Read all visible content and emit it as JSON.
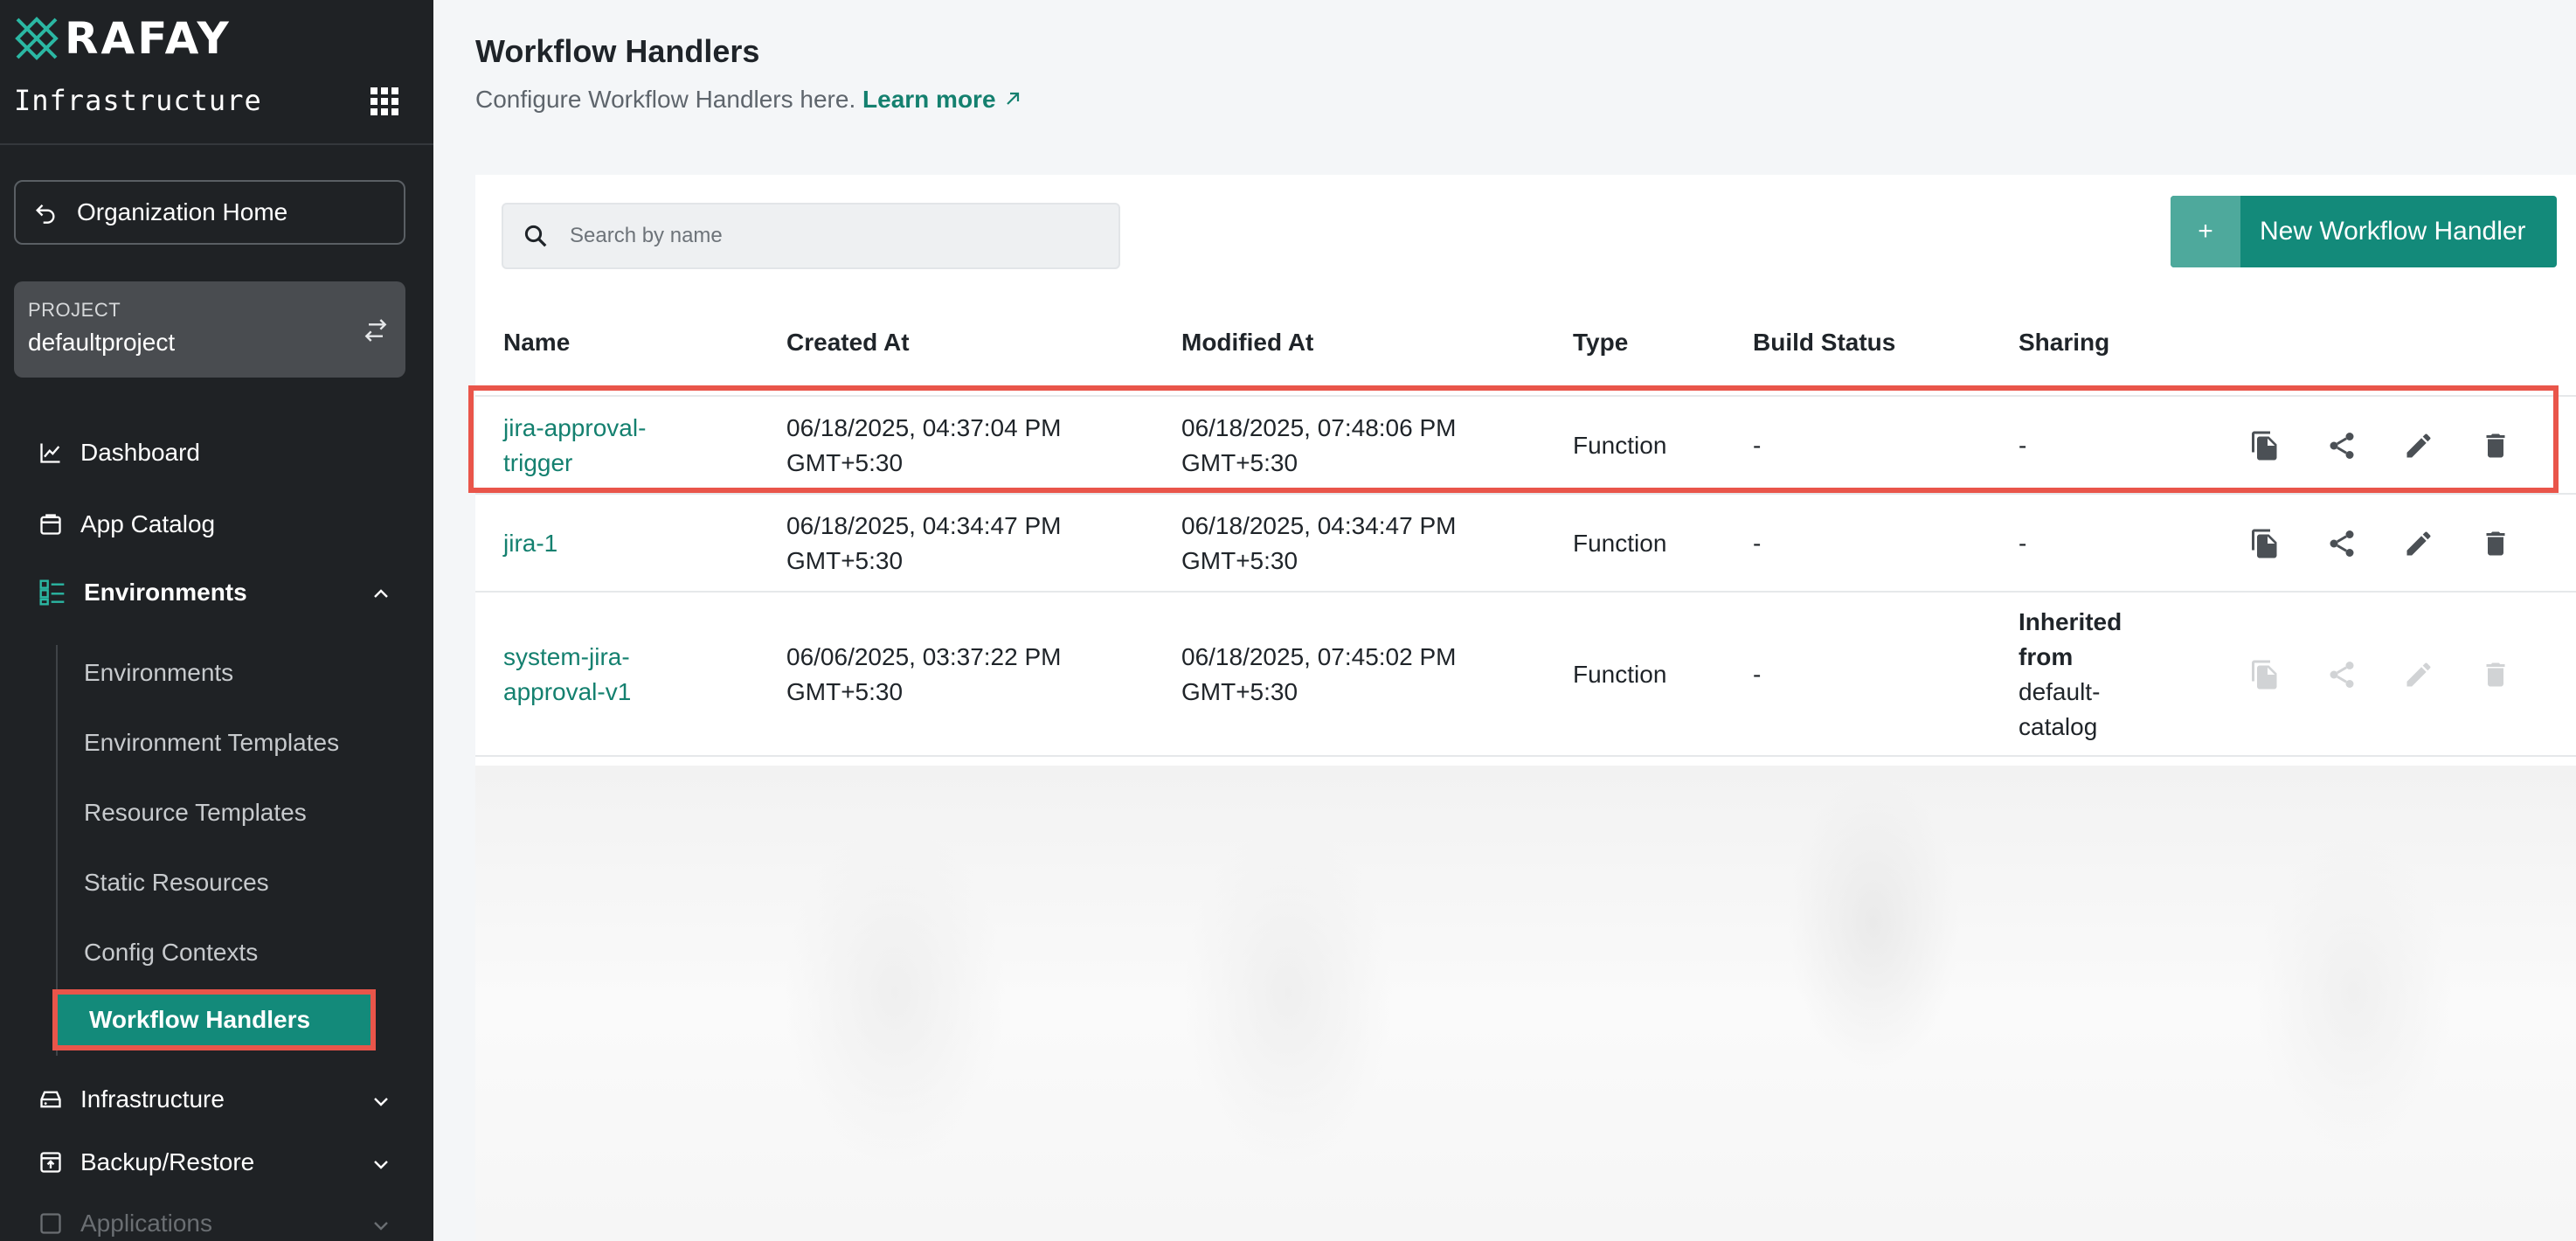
{
  "sidebar": {
    "logo_text": "RAFAY",
    "section_title": "Infrastructure",
    "org_home_label": "Organization Home",
    "project_caption": "PROJECT",
    "project_name": "defaultproject",
    "nav": {
      "dashboard": "Dashboard",
      "app_catalog": "App Catalog",
      "environments": "Environments",
      "infrastructure": "Infrastructure",
      "backup_restore": "Backup/Restore",
      "applications": "Applications"
    },
    "sub_items": {
      "environments": "Environments",
      "environment_templates": "Environment Templates",
      "resource_templates": "Resource Templates",
      "static_resources": "Static Resources",
      "config_contexts": "Config Contexts",
      "workflow_handlers": "Workflow Handlers"
    }
  },
  "header": {
    "title": "Workflow Handlers",
    "subtitle": "Configure Workflow Handlers here.",
    "learn_more": "Learn more"
  },
  "toolbar": {
    "search_placeholder": "Search by name",
    "new_button_plus": "+",
    "new_button_label": "New Workflow Handler"
  },
  "table": {
    "headers": {
      "name": "Name",
      "created": "Created At",
      "modified": "Modified At",
      "type": "Type",
      "build": "Build Status",
      "sharing": "Sharing"
    },
    "rows": [
      {
        "name_l1": "jira-approval-",
        "name_l2": "trigger",
        "created_l1": "06/18/2025, 04:37:04 PM",
        "created_l2": "GMT+5:30",
        "modified_l1": "06/18/2025, 07:48:06 PM",
        "modified_l2": "GMT+5:30",
        "type": "Function",
        "build": "-",
        "sharing": "-"
      },
      {
        "name_l1": "jira-1",
        "created_l1": "06/18/2025, 04:34:47 PM",
        "created_l2": "GMT+5:30",
        "modified_l1": "06/18/2025, 04:34:47 PM",
        "modified_l2": "GMT+5:30",
        "type": "Function",
        "build": "-",
        "sharing": "-"
      },
      {
        "name_l1": "system-jira-",
        "name_l2": "approval-v1",
        "created_l1": "06/06/2025, 03:37:22 PM",
        "created_l2": "GMT+5:30",
        "modified_l1": "06/18/2025, 07:45:02 PM",
        "modified_l2": "GMT+5:30",
        "type": "Function",
        "build": "-",
        "sharing_bold_l1": "Inherited",
        "sharing_bold_l2": "from",
        "sharing_l3": "default-",
        "sharing_l4": "catalog"
      }
    ]
  },
  "colors": {
    "sidebar_bg": "#1f2225",
    "accent": "#138a7a",
    "link": "#14806f",
    "highlight": "#e9554a"
  }
}
